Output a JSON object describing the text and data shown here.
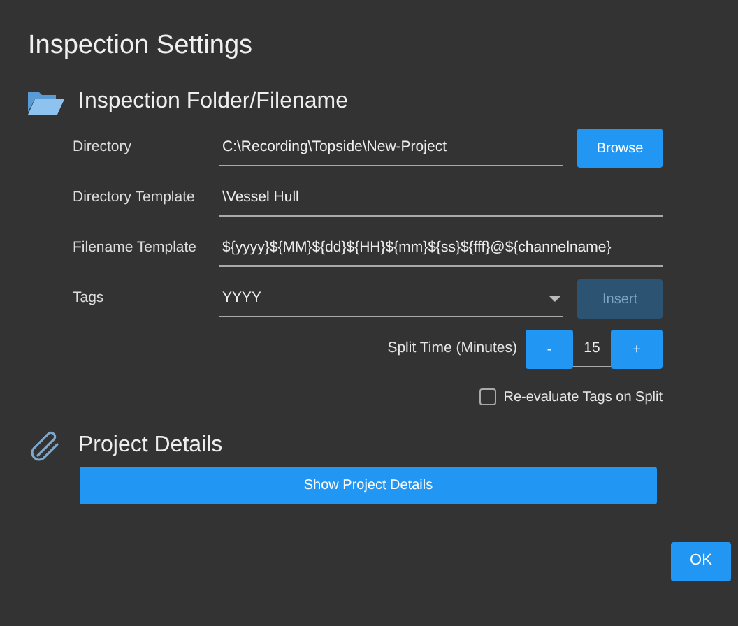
{
  "window": {
    "title": "Inspection Settings"
  },
  "folder_section": {
    "title": "Inspection Folder/Filename",
    "fields": [
      {
        "kind": "text",
        "label": "Directory",
        "value": "C:\\Recording\\Topside\\New-Project",
        "button": {
          "label": "Browse",
          "disabled": false
        }
      },
      {
        "kind": "text",
        "label": "Directory Template",
        "value": "\\Vessel Hull"
      },
      {
        "kind": "text",
        "label": "Filename Template",
        "value": "${yyyy}${MM}${dd}${HH}${mm}${ss}${fff}@${channelname}"
      },
      {
        "kind": "dropdown",
        "label": "Tags",
        "value": "YYYY",
        "button": {
          "label": "Insert",
          "disabled": true
        }
      }
    ],
    "split_time": {
      "label": "Split Time (Minutes)",
      "decrement": "-",
      "value": "15",
      "increment": "+"
    },
    "reevaluate": {
      "label": "Re-evaluate Tags on Split",
      "checked": false
    }
  },
  "project_section": {
    "title": "Project Details",
    "button": "Show Project Details"
  },
  "ok_button": "OK"
}
